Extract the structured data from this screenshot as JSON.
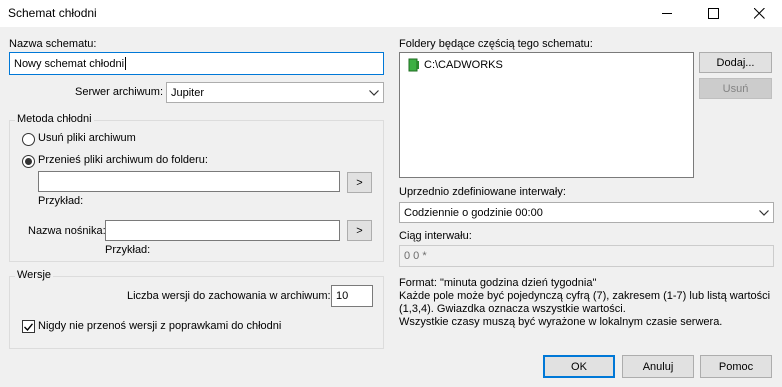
{
  "window": {
    "title": "Schemat chłodni"
  },
  "left": {
    "schema_name_label": "Nazwa schematu:",
    "schema_name_value": "Nowy schemat chłodni",
    "archive_server_label": "Serwer archiwum:",
    "archive_server_value": "Jupiter",
    "method_group_label": "Metoda chłodni",
    "radio_delete_label": "Usuń pliki archiwum",
    "radio_move_label": "Przenieś pliki archiwum do folderu:",
    "radio_selected": "move",
    "folder_value": "",
    "browse_label": ">",
    "example_label_1": "Przykład:",
    "media_name_label": "Nazwa nośnika:",
    "media_name_value": "",
    "example_label_2": "Przykład:",
    "versions_group_label": "Wersje",
    "versions_count_label": "Liczba wersji do zachowania w archiwum:",
    "versions_count_value": "10",
    "never_move_label": "Nigdy nie przenoś wersji z poprawkami do chłodni",
    "never_move_checked": true
  },
  "right": {
    "folders_label": "Foldery będące częścią tego schematu:",
    "folders": [
      {
        "name": "C:\\CADWORKS",
        "icon": "vault-folder-icon"
      }
    ],
    "add_label": "Dodaj...",
    "remove_label": "Usuń",
    "intervals_label": "Uprzednio zdefiniowane interwały:",
    "intervals_value": "Codziennie o godzinie 00:00",
    "interval_string_label": "Ciąg interwału:",
    "interval_string_value": "0 0 *",
    "format_line1": "Format: \"minuta godzina dzień tygodnia\"",
    "format_line2": "Każde pole może być pojedynczą cyfrą (7), zakresem (1-7) lub listą wartości",
    "format_line3": "(1,3,4). Gwiazdka oznacza wszystkie wartości.",
    "format_line4": "Wszystkie czasy muszą być wyrażone w lokalnym czasie serwera."
  },
  "footer": {
    "ok_label": "OK",
    "cancel_label": "Anuluj",
    "help_label": "Pomoc"
  },
  "colors": {
    "accent": "#0078d7",
    "folder_icon": "#3cb043"
  }
}
